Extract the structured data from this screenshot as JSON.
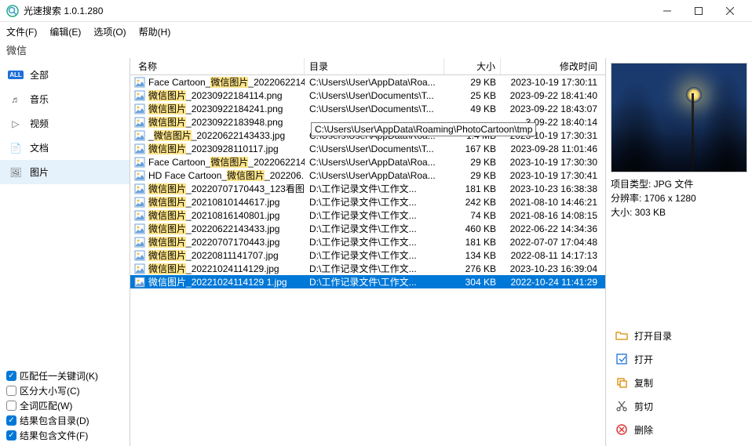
{
  "app_title": "光速搜索 1.0.1.280",
  "menu": {
    "file": "文件(F)",
    "edit": "编辑(E)",
    "options": "选项(O)",
    "help": "帮助(H)"
  },
  "search_query": "微信",
  "sidebar": {
    "items": [
      {
        "label": "全部",
        "icon": "all"
      },
      {
        "label": "音乐",
        "icon": "music"
      },
      {
        "label": "视频",
        "icon": "video"
      },
      {
        "label": "文档",
        "icon": "doc"
      },
      {
        "label": "图片",
        "icon": "image"
      }
    ],
    "selected": 4
  },
  "columns": {
    "name": "名称",
    "dir": "目录",
    "size": "大小",
    "date": "修改时间"
  },
  "tooltip_text": "C:\\Users\\User\\AppData\\Roaming\\PhotoCartoon\\tmp",
  "rows": [
    {
      "name_pre": "Face Cartoon_",
      "name_hl": "微信图片",
      "name_post": "_2022062214...",
      "dir": "C:\\Users\\User\\AppData\\Roa...",
      "size": "29 KB",
      "date": "2023-10-19 17:30:11"
    },
    {
      "name_pre": "",
      "name_hl": "微信图片",
      "name_post": "_20230922184114.png",
      "dir": "C:\\Users\\User\\Documents\\T...",
      "size": "25 KB",
      "date": "2023-09-22 18:41:40"
    },
    {
      "name_pre": "",
      "name_hl": "微信图片",
      "name_post": "_20230922184241.png",
      "dir": "C:\\Users\\User\\Documents\\T...",
      "size": "49 KB",
      "date": "2023-09-22 18:43:07"
    },
    {
      "name_pre": "",
      "name_hl": "微信图片",
      "name_post": "_20230922183948.png",
      "dir": "",
      "size": "",
      "date": "3-09-22 18:40:14",
      "tooltip": true
    },
    {
      "name_pre": "_",
      "name_hl": "微信图片",
      "name_post": "_20220622143433.jpg",
      "dir": "C:\\Users\\User\\AppData\\Roa...",
      "size": "1.4 MB",
      "date": "2023-10-19 17:30:31"
    },
    {
      "name_pre": "",
      "name_hl": "微信图片",
      "name_post": "_20230928110117.jpg",
      "dir": "C:\\Users\\User\\Documents\\T...",
      "size": "167 KB",
      "date": "2023-09-28 11:01:46"
    },
    {
      "name_pre": "Face Cartoon_",
      "name_hl": "微信图片",
      "name_post": "_2022062214...",
      "dir": "C:\\Users\\User\\AppData\\Roa...",
      "size": "29 KB",
      "date": "2023-10-19 17:30:30"
    },
    {
      "name_pre": "HD Face Cartoon_",
      "name_hl": "微信图片",
      "name_post": "_202206...",
      "dir": "C:\\Users\\User\\AppData\\Roa...",
      "size": "29 KB",
      "date": "2023-10-19 17:30:41"
    },
    {
      "name_pre": "",
      "name_hl": "微信图片",
      "name_post": "_20220707170443_123看图...",
      "dir": "D:\\工作记录文件\\工作文...",
      "size": "181 KB",
      "date": "2023-10-23 16:38:38"
    },
    {
      "name_pre": "",
      "name_hl": "微信图片",
      "name_post": "_20210810144617.jpg",
      "dir": "D:\\工作记录文件\\工作文...",
      "size": "242 KB",
      "date": "2021-08-10 14:46:21"
    },
    {
      "name_pre": "",
      "name_hl": "微信图片",
      "name_post": "_20210816140801.jpg",
      "dir": "D:\\工作记录文件\\工作文...",
      "size": "74 KB",
      "date": "2021-08-16 14:08:15"
    },
    {
      "name_pre": "",
      "name_hl": "微信图片",
      "name_post": "_20220622143433.jpg",
      "dir": "D:\\工作记录文件\\工作文...",
      "size": "460 KB",
      "date": "2022-06-22 14:34:36"
    },
    {
      "name_pre": "",
      "name_hl": "微信图片",
      "name_post": "_20220707170443.jpg",
      "dir": "D:\\工作记录文件\\工作文...",
      "size": "181 KB",
      "date": "2022-07-07 17:04:48"
    },
    {
      "name_pre": "",
      "name_hl": "微信图片",
      "name_post": "_20220811141707.jpg",
      "dir": "D:\\工作记录文件\\工作文...",
      "size": "134 KB",
      "date": "2022-08-11 14:17:13"
    },
    {
      "name_pre": "",
      "name_hl": "微信图片",
      "name_post": "_20221024114129.jpg",
      "dir": "D:\\工作记录文件\\工作文...",
      "size": "276 KB",
      "date": "2023-10-23 16:39:04"
    },
    {
      "name_pre": "",
      "name_hl": "微信图片",
      "name_post": "_20221024114129 1.jpg",
      "dir": "D:\\工作记录文件\\工作文...",
      "size": "304 KB",
      "date": "2022-10-24 11:41:29",
      "selected": true
    }
  ],
  "details": {
    "type_label": "项目类型: ",
    "type_value": "JPG 文件",
    "res_label": "分辨率: ",
    "res_value": "1706 x 1280",
    "size_label": "大小: ",
    "size_value": "303 KB"
  },
  "actions": {
    "open_dir": "打开目录",
    "open": "打开",
    "copy": "复制",
    "cut": "剪切",
    "delete": "删除"
  },
  "opts": {
    "any_keyword": "匹配任一关键词(K)",
    "case": "区分大小写(C)",
    "whole": "全词匹配(W)",
    "incl_dir": "结果包含目录(D)",
    "incl_file": "结果包含文件(F)"
  }
}
